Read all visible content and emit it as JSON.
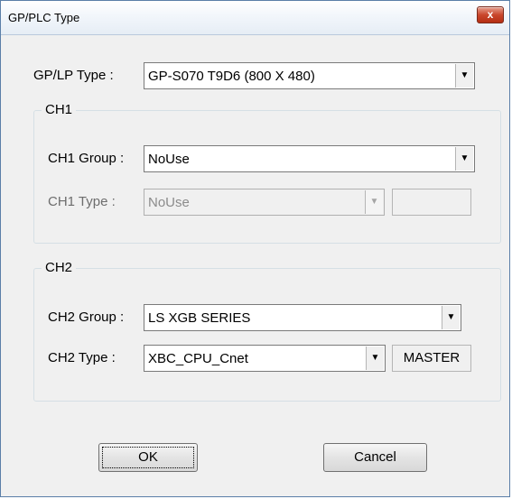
{
  "window": {
    "title": "GP/PLC Type",
    "close_glyph": "x"
  },
  "gp_type": {
    "label": "GP/LP Type :",
    "value": "GP-S070  T9D6  (800 X 480)"
  },
  "ch1": {
    "group_title": "CH1",
    "group_label": "CH1 Group :",
    "group_value": "NoUse",
    "type_label": "CH1 Type :",
    "type_value": "NoUse",
    "type_extra": ""
  },
  "ch2": {
    "group_title": "CH2",
    "group_label": "CH2 Group :",
    "group_value": "LS XGB SERIES",
    "type_label": "CH2 Type :",
    "type_value": "XBC_CPU_Cnet",
    "type_extra": "MASTER"
  },
  "buttons": {
    "ok": "OK",
    "cancel": "Cancel"
  },
  "icons": {
    "dropdown": "chevron-down-icon",
    "close": "close-icon"
  }
}
